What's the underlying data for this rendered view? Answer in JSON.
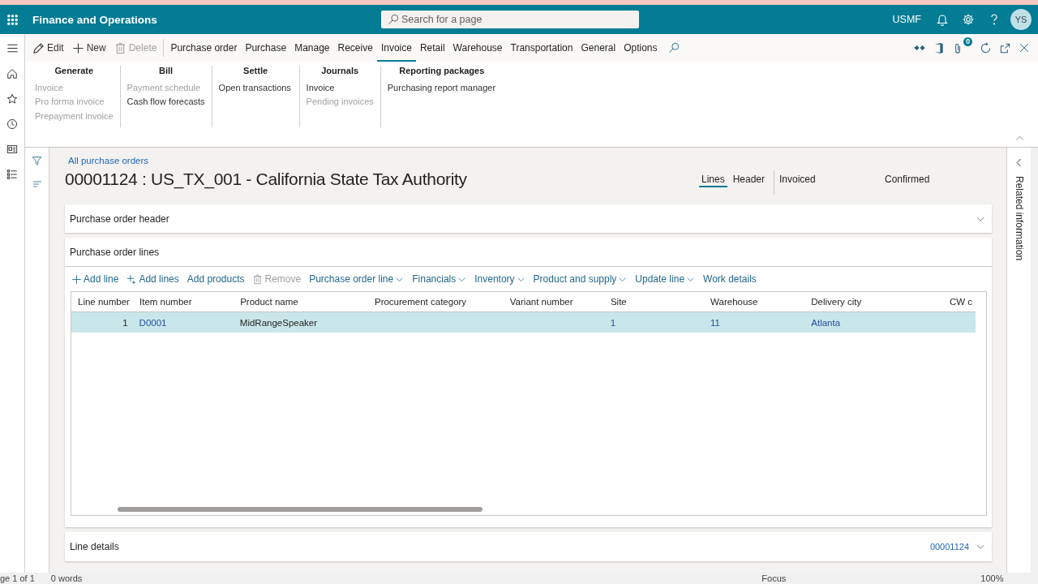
{
  "header": {
    "app_title": "Finance and Operations",
    "search_placeholder": "Search for a page",
    "company": "USMF",
    "avatar": "YS"
  },
  "action_pane": {
    "commands": [
      {
        "kind": "edit",
        "label": "Edit",
        "disabled": false
      },
      {
        "kind": "new",
        "label": "New",
        "disabled": false
      },
      {
        "kind": "delete",
        "label": "Delete",
        "disabled": true
      }
    ],
    "tabs": [
      {
        "label": "Purchase order",
        "selected": false
      },
      {
        "label": "Purchase",
        "selected": false
      },
      {
        "label": "Manage",
        "selected": false
      },
      {
        "label": "Receive",
        "selected": false
      },
      {
        "label": "Invoice",
        "selected": true
      },
      {
        "label": "Retail",
        "selected": false
      },
      {
        "label": "Warehouse",
        "selected": false
      },
      {
        "label": "Transportation",
        "selected": false
      },
      {
        "label": "General",
        "selected": false
      },
      {
        "label": "Options",
        "selected": false
      }
    ],
    "attachments": "0"
  },
  "ribbon": {
    "groups": [
      {
        "title": "Generate",
        "items": [
          {
            "label": "Invoice",
            "disabled": true
          },
          {
            "label": "Pro forma invoice",
            "disabled": true
          },
          {
            "label": "Prepayment invoice",
            "disabled": true
          }
        ]
      },
      {
        "title": "Bill",
        "items": [
          {
            "label": "Payment schedule",
            "disabled": true
          },
          {
            "label": "Cash flow forecasts",
            "disabled": false
          }
        ]
      },
      {
        "title": "Settle",
        "items": [
          {
            "label": "Open transactions",
            "disabled": false
          }
        ]
      },
      {
        "title": "Journals",
        "items": [
          {
            "label": "Invoice",
            "disabled": false
          },
          {
            "label": "Pending invoices",
            "disabled": true
          }
        ]
      },
      {
        "title": "Reporting packages",
        "items": [
          {
            "label": "Purchasing report manager",
            "disabled": false
          }
        ]
      }
    ]
  },
  "page": {
    "breadcrumb": "All purchase orders",
    "title": "00001124 : US_TX_001 - California State Tax Authority",
    "views": [
      {
        "label": "Lines",
        "selected": true
      },
      {
        "label": "Header",
        "selected": false
      }
    ],
    "statuses": [
      "Invoiced",
      "Confirmed"
    ]
  },
  "header_section": {
    "title": "Purchase order header"
  },
  "lines_section": {
    "title": "Purchase order lines",
    "toolbar": [
      {
        "kind": "add",
        "label": "Add line",
        "disabled": false
      },
      {
        "kind": "add_multi",
        "label": "Add lines",
        "disabled": false
      },
      {
        "kind": "plain",
        "label": "Add products",
        "disabled": false
      },
      {
        "kind": "remove",
        "label": "Remove",
        "disabled": true
      },
      {
        "kind": "menu",
        "label": "Purchase order line",
        "disabled": false
      },
      {
        "kind": "menu",
        "label": "Financials",
        "disabled": false
      },
      {
        "kind": "menu",
        "label": "Inventory",
        "disabled": false
      },
      {
        "kind": "menu",
        "label": "Product and supply",
        "disabled": false
      },
      {
        "kind": "menu",
        "label": "Update line",
        "disabled": false
      },
      {
        "kind": "plain",
        "label": "Work details",
        "disabled": false
      }
    ],
    "grid": {
      "columns": [
        "Line number",
        "Item number",
        "Product name",
        "Procurement category",
        "Variant number",
        "Site",
        "Warehouse",
        "Delivery city",
        "CW c"
      ],
      "rows": [
        {
          "selected": true,
          "line_number": "1",
          "item_number": "D0001",
          "product_name": "MidRangeSpeaker",
          "site": "1",
          "warehouse": "11",
          "delivery_city": "Atlanta"
        }
      ]
    }
  },
  "details_section": {
    "title": "Line details",
    "summary": "00001124"
  },
  "related_pane": {
    "title": "Related information"
  },
  "status_bar": {
    "page": "ge 1 of 1",
    "words": "0 words",
    "focus": "Focus",
    "zoom": "100%"
  }
}
